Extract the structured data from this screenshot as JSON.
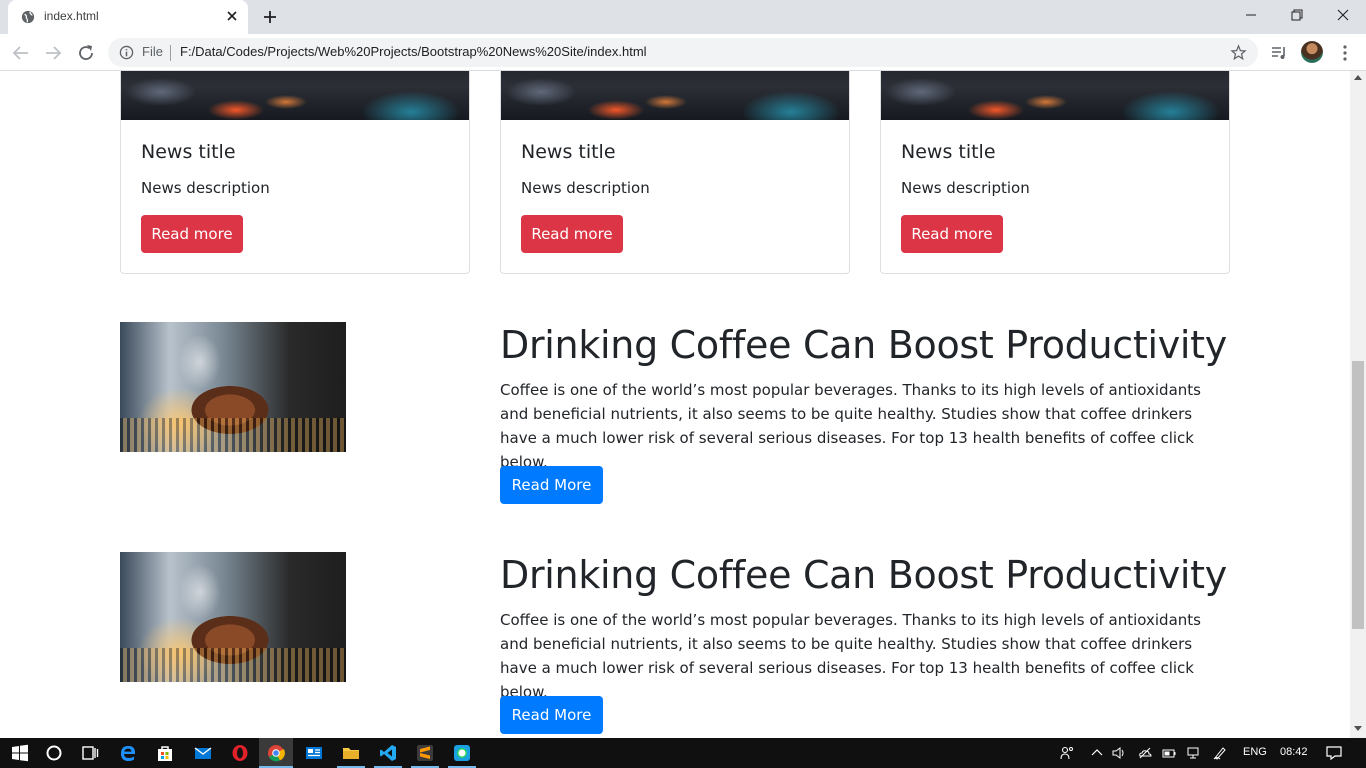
{
  "browser": {
    "tab_title": "index.html",
    "file_label": "File",
    "url": "F:/Data/Codes/Projects/Web%20Projects/Bootstrap%20News%20Site/index.html"
  },
  "cards": [
    {
      "title": "News title",
      "description": "News description",
      "button": "Read more"
    },
    {
      "title": "News title",
      "description": "News description",
      "button": "Read more"
    },
    {
      "title": "News title",
      "description": "News description",
      "button": "Read more"
    }
  ],
  "articles": [
    {
      "title": "Drinking Coffee Can Boost Productivity",
      "text": "Coffee is one of the world’s most popular beverages. Thanks to its high levels of antioxidants and beneficial nutrients, it also seems to be quite healthy. Studies show that coffee drinkers have a much lower risk of several serious diseases. For top 13 health benefits of coffee click below.",
      "button": "Read More"
    },
    {
      "title": "Drinking Coffee Can Boost Productivity",
      "text": "Coffee is one of the world’s most popular beverages. Thanks to its high levels of antioxidants and beneficial nutrients, it also seems to be quite healthy. Studies show that coffee drinkers have a much lower risk of several serious diseases. For top 13 health benefits of coffee click below.",
      "button": "Read More"
    }
  ],
  "taskbar": {
    "language": "ENG",
    "time": "08:42",
    "apps": [
      "start-icon",
      "cortana-icon",
      "task-view-icon",
      "edge-icon",
      "store-icon",
      "mail-icon",
      "opera-icon",
      "chrome-icon",
      "news-app-icon",
      "file-explorer-icon",
      "vscode-icon",
      "sublime-text-icon",
      "whatsapp-icon"
    ]
  },
  "colors": {
    "danger": "#dc3545",
    "primary": "#007bff",
    "text": "#212529",
    "tab_strip": "#dee1e6",
    "taskbar": "#101010"
  },
  "scroll_position": 0.55
}
